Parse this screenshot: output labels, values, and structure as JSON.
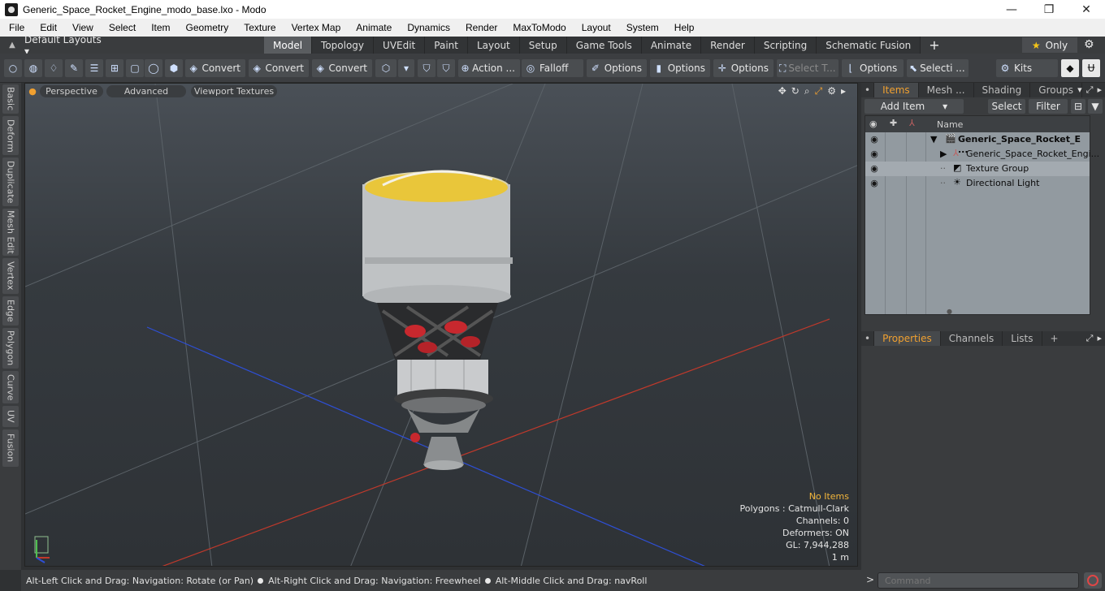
{
  "window": {
    "title": "Generic_Space_Rocket_Engine_modo_base.lxo - Modo",
    "minimize": "—",
    "maximize": "❐",
    "close": "✕"
  },
  "menu": [
    "File",
    "Edit",
    "View",
    "Select",
    "Item",
    "Geometry",
    "Texture",
    "Vertex Map",
    "Animate",
    "Dynamics",
    "Render",
    "MaxToModo",
    "Layout",
    "System",
    "Help"
  ],
  "layout": {
    "selector": "Default Layouts ▾",
    "tabs": [
      "Model",
      "Topology",
      "UVEdit",
      "Paint",
      "Layout",
      "Setup",
      "Game Tools",
      "Animate",
      "Render",
      "Scripting",
      "Schematic Fusion"
    ],
    "active_tab": "Model",
    "add": "+",
    "only_label": "Only"
  },
  "toolbar": {
    "convert1": "Convert",
    "convert2": "Convert",
    "convert3": "Convert",
    "action": "Action ...",
    "falloff": "Falloff",
    "options1": "Options",
    "options2": "Options",
    "options3": "Options",
    "select_t": "Select T...",
    "options4": "Options",
    "selecti": "Selecti ...",
    "kits": "Kits"
  },
  "left_tabs": [
    "Basic",
    "Deform",
    "Duplicate",
    "Mesh Edit",
    "Vertex",
    "Edge",
    "Polygon",
    "Curve",
    "UV",
    "Fusion"
  ],
  "viewport": {
    "view_label": "Perspective",
    "shading_label": "Advanced",
    "textures_label": "Viewport Textures",
    "info": {
      "selection": "No Items",
      "polygons": "Polygons : Catmull-Clark",
      "channels": "Channels: 0",
      "deformers": "Deformers: ON",
      "gl": "GL: 7,944,288",
      "scale": "1 m"
    }
  },
  "status": {
    "hint1": "Alt-Left Click and Drag: Navigation: Rotate (or Pan)",
    "hint2": "Alt-Right Click and Drag: Navigation: Freewheel",
    "hint3": "Alt-Middle Click and Drag: navRoll"
  },
  "items_panel": {
    "tabs": [
      "Items",
      "Mesh ...",
      "Shading",
      "Groups"
    ],
    "active_tab": "Items",
    "add_item": "Add Item",
    "select": "Select",
    "filter": "Filter",
    "column_name": "Name",
    "rows": [
      {
        "label": "Generic_Space_Rocket_E ...",
        "icon": "scene-icon"
      },
      {
        "label": "Generic_Space_Rocket_Engi...",
        "icon": "mesh-icon"
      },
      {
        "label": "Texture Group",
        "icon": "texture-group-icon"
      },
      {
        "label": "Directional Light",
        "icon": "light-icon"
      }
    ]
  },
  "properties_panel": {
    "tabs": [
      "Properties",
      "Channels",
      "Lists"
    ],
    "active_tab": "Properties",
    "add": "+"
  },
  "command": {
    "prompt": ">",
    "placeholder": "Command"
  },
  "colors": {
    "accent": "#f0a030",
    "x_axis": "#c0392b",
    "z_axis": "#2e4fd6"
  }
}
